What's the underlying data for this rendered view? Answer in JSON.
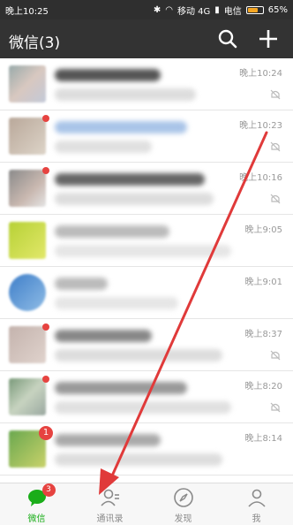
{
  "status_bar": {
    "time": "晚上10:25",
    "carrier_1": "移动 4G",
    "carrier_2": "电信",
    "battery": "65%",
    "battery_level": 0.65
  },
  "app_bar": {
    "title": "微信(3)",
    "search_icon": "search-icon",
    "add_icon": "plus-icon"
  },
  "chats": [
    {
      "time": "晚上10:24",
      "muted": true,
      "unread_dot": false
    },
    {
      "time": "晚上10:23",
      "muted": true,
      "unread_dot": true
    },
    {
      "time": "晚上10:16",
      "muted": true,
      "unread_dot": true
    },
    {
      "time": "晚上9:05",
      "muted": false,
      "unread_dot": false
    },
    {
      "time": "晚上9:01",
      "muted": false,
      "unread_dot": false
    },
    {
      "time": "晚上8:37",
      "muted": true,
      "unread_dot": true
    },
    {
      "time": "晚上8:20",
      "muted": true,
      "unread_dot": true
    },
    {
      "time": "晚上8:14",
      "muted": false,
      "unread_badge": "1"
    }
  ],
  "tab_bar": {
    "tabs": [
      {
        "label": "微信",
        "icon": "chat-bubble-icon",
        "badge": "3",
        "active": true
      },
      {
        "label": "通讯录",
        "icon": "contacts-icon",
        "active": false
      },
      {
        "label": "发现",
        "icon": "compass-icon",
        "active": false
      },
      {
        "label": "我",
        "icon": "person-icon",
        "active": false
      }
    ]
  },
  "colors": {
    "header": "#333333",
    "accent": "#1aad19",
    "badge": "#e64340",
    "annotation_arrow": "#e03a3a"
  }
}
